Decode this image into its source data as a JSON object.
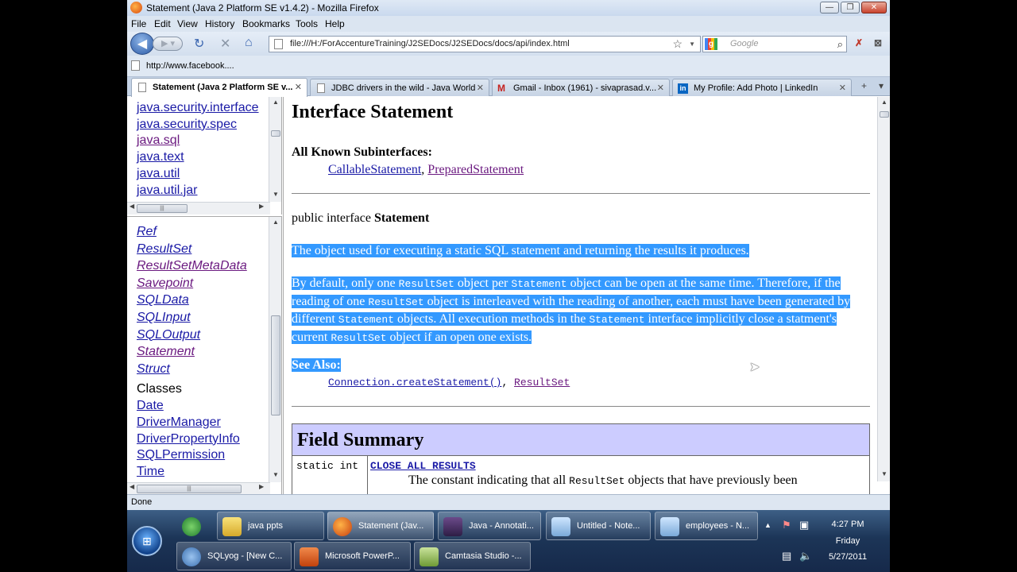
{
  "window": {
    "title": "Statement (Java 2 Platform SE v1.4.2) - Mozilla Firefox",
    "buttons": {
      "minimize": "—",
      "restore": "❐",
      "close": "✕"
    }
  },
  "menu": [
    "File",
    "Edit",
    "View",
    "History",
    "Bookmarks",
    "Tools",
    "Help"
  ],
  "nav": {
    "url": "file:///H:/ForAccentureTraining/J2SEDocs/J2SEDocs/docs/api/index.html",
    "search_placeholder": "Google"
  },
  "bookmarks": {
    "item": "http://www.facebook...."
  },
  "tabs": [
    {
      "label": "Statement (Java 2 Platform SE v...",
      "active": true
    },
    {
      "label": "JDBC drivers in the wild - Java World"
    },
    {
      "label": "Gmail - Inbox (1961) - sivaprasad.v..."
    },
    {
      "label": "My Profile: Add Photo | LinkedIn"
    }
  ],
  "packages": [
    {
      "label": "java.security.interface",
      "visited": false
    },
    {
      "label": "java.security.spec",
      "visited": false
    },
    {
      "label": "java.sql",
      "visited": true
    },
    {
      "label": "java.text",
      "visited": false
    },
    {
      "label": "java.util",
      "visited": false
    },
    {
      "label": "java.util.jar",
      "visited": false
    }
  ],
  "interfaces": [
    {
      "label": "Ref",
      "visited": false
    },
    {
      "label": "ResultSet",
      "visited": false
    },
    {
      "label": "ResultSetMetaData",
      "visited": true
    },
    {
      "label": "Savepoint",
      "visited": true
    },
    {
      "label": "SQLData",
      "visited": false
    },
    {
      "label": "SQLInput",
      "visited": false
    },
    {
      "label": "SQLOutput",
      "visited": false
    },
    {
      "label": "Statement",
      "visited": true
    },
    {
      "label": "Struct",
      "visited": false
    }
  ],
  "classes_header": "Classes",
  "classes": [
    "Date",
    "DriverManager",
    "DriverPropertyInfo",
    "SQLPermission",
    "Time"
  ],
  "doc": {
    "title": "Interface Statement",
    "subinterfaces_header": "All Known Subinterfaces:",
    "subinterfaces": [
      "CallableStatement",
      "PreparedStatement"
    ],
    "decl_prefix": "public interface ",
    "decl_name": "Statement",
    "p1": "The object used for executing a static SQL statement and returning the results it produces.",
    "p2": [
      "By default, only one ",
      "ResultSet",
      " object per ",
      "Statement",
      " object can be open at the same time. Therefore, if the reading of one ",
      "ResultSet",
      " object is interleaved with the reading of another, each must have been generated by different ",
      "Statement",
      " objects. All execution methods in the ",
      "Statement",
      " interface implicitly close a statment's current ",
      "ResultSet",
      " object if an open one exists."
    ],
    "see_also": "See Also:",
    "see_links": [
      "Connection.createStatement()",
      "ResultSet"
    ],
    "field_summary": "Field Summary",
    "field_type": "static int",
    "field_name": "CLOSE_ALL_RESULTS",
    "field_desc_start": "The constant indicating that all ",
    "field_desc_code": "ResultSet",
    "field_desc_end": " objects that have previously been"
  },
  "status": "Done",
  "taskbar": {
    "row1": [
      "java ppts",
      "Statement (Jav...",
      "Java - Annotati...",
      "Untitled - Note...",
      "employees - N..."
    ],
    "row2": [
      "SQLyog - [New C...",
      "Microsoft PowerP...",
      "Camtasia Studio -..."
    ],
    "time": "4:27 PM",
    "day": "Friday",
    "date": "5/27/2011"
  }
}
